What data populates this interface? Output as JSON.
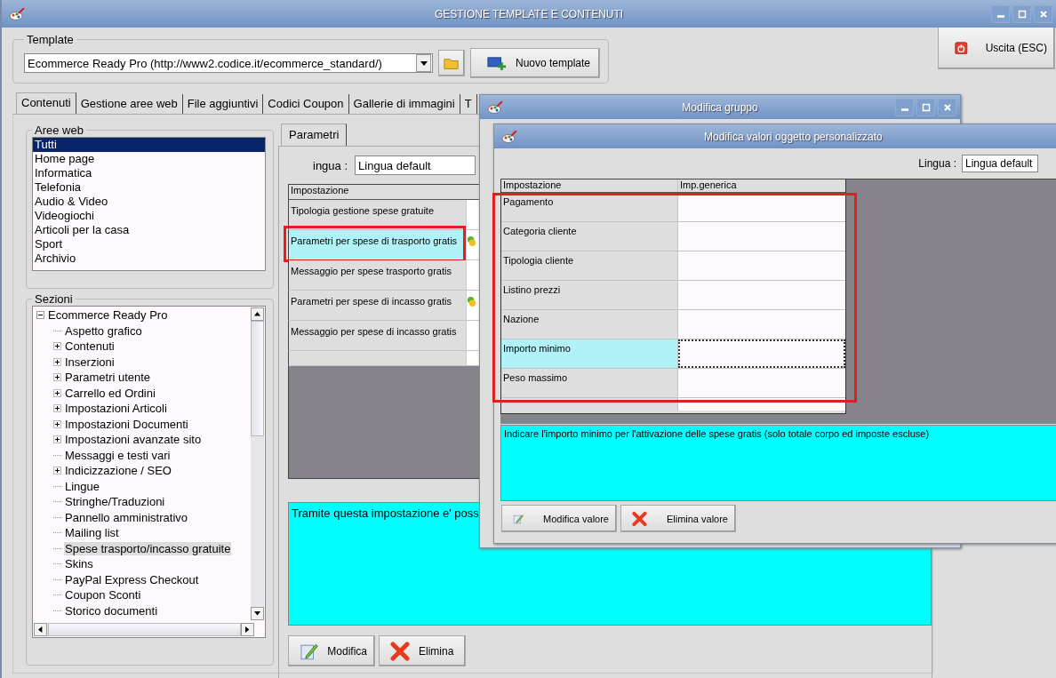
{
  "window": {
    "title": "GESTIONE TEMPLATE E CONTENUTI"
  },
  "template": {
    "label": "Template",
    "value": "Ecommerce Ready Pro (http://www2.codice.it/ecommerce_standard/)",
    "new_button": "Nuovo template"
  },
  "exit_button": "Uscita (ESC)",
  "tabs": [
    {
      "label": "Contenuti",
      "selected": true
    },
    {
      "label": "Gestione aree web",
      "selected": false
    },
    {
      "label": "File aggiuntivi",
      "selected": false
    },
    {
      "label": "Codici Coupon",
      "selected": false
    },
    {
      "label": "Gallerie di immagini",
      "selected": false
    },
    {
      "label": "T",
      "selected": false
    }
  ],
  "web_areas": {
    "label": "Aree web",
    "items": [
      {
        "label": "Tutti",
        "selected": true
      },
      {
        "label": "Home page",
        "selected": false
      },
      {
        "label": "Informatica",
        "selected": false
      },
      {
        "label": "Telefonia",
        "selected": false
      },
      {
        "label": "Audio & Video",
        "selected": false
      },
      {
        "label": "Videogiochi",
        "selected": false
      },
      {
        "label": "Articoli per la casa",
        "selected": false
      },
      {
        "label": "Sport",
        "selected": false
      },
      {
        "label": "Archivio",
        "selected": false
      }
    ]
  },
  "sections": {
    "label": "Sezioni",
    "tree": [
      {
        "label": "Ecommerce Ready Pro",
        "expanded": true,
        "selected": false,
        "children": [
          {
            "label": "Aspetto grafico",
            "expandable": false,
            "selected": false
          },
          {
            "label": "Contenuti",
            "expandable": true,
            "selected": false
          },
          {
            "label": "Inserzioni",
            "expandable": true,
            "selected": false
          },
          {
            "label": "Parametri utente",
            "expandable": true,
            "selected": false
          },
          {
            "label": "Carrello ed Ordini",
            "expandable": true,
            "selected": false
          },
          {
            "label": "Impostazioni Articoli",
            "expandable": true,
            "selected": false
          },
          {
            "label": "Impostazioni Documenti",
            "expandable": true,
            "selected": false
          },
          {
            "label": "Impostazioni avanzate sito",
            "expandable": true,
            "selected": false
          },
          {
            "label": "Messaggi e testi vari",
            "expandable": false,
            "selected": false
          },
          {
            "label": "Indicizzazione / SEO",
            "expandable": true,
            "selected": false
          },
          {
            "label": "Lingue",
            "expandable": false,
            "selected": false
          },
          {
            "label": "Stringhe/Traduzioni",
            "expandable": false,
            "selected": false
          },
          {
            "label": "Pannello amministrativo",
            "expandable": false,
            "selected": false
          },
          {
            "label": "Mailing list",
            "expandable": false,
            "selected": false
          },
          {
            "label": "Spese trasporto/incasso gratuite",
            "expandable": false,
            "selected": true
          },
          {
            "label": "Skins",
            "expandable": false,
            "selected": false
          },
          {
            "label": "PayPal Express Checkout",
            "expandable": false,
            "selected": false
          },
          {
            "label": "Coupon Sconti",
            "expandable": false,
            "selected": false
          },
          {
            "label": "Storico documenti",
            "expandable": false,
            "selected": false
          }
        ]
      }
    ]
  },
  "parameters": {
    "tab": "Parametri",
    "language_label": "ingua :",
    "language": "Lingua default",
    "column": "Impostazione",
    "rows": [
      {
        "label": "Tipologia gestione spese gratuite",
        "kind": "text",
        "selected": false,
        "highlighted": false
      },
      {
        "label": "Parametri per spese di trasporto gratis",
        "kind": "group",
        "selected": true,
        "highlighted": true
      },
      {
        "label": "Messaggio per spese trasporto gratis",
        "kind": "text",
        "selected": false,
        "highlighted": false
      },
      {
        "label": "Parametri per spese di incasso gratis",
        "kind": "group",
        "selected": false,
        "highlighted": false
      },
      {
        "label": "Messaggio per spese di incasso gratis",
        "kind": "text",
        "selected": false,
        "highlighted": false
      }
    ],
    "description": "Tramite questa impostazione e' poss",
    "buttons": [
      {
        "label": "Modifica",
        "kind": "edit"
      },
      {
        "label": "Elimina",
        "kind": "delete"
      }
    ]
  },
  "dialogs": [
    {
      "title": "Modifica gruppo"
    },
    {
      "title": "Modifica valori oggetto personalizzato",
      "language_label": "Lingua :",
      "language": "Lingua default",
      "highlighted": true,
      "columns": [
        "Impostazione",
        "Imp.generica"
      ],
      "rows": [
        {
          "label": "Pagamento",
          "selected": false
        },
        {
          "label": "Categoria cliente",
          "selected": false
        },
        {
          "label": "Tipologia cliente",
          "selected": false
        },
        {
          "label": "Listino prezzi",
          "selected": false
        },
        {
          "label": "Nazione",
          "selected": false
        },
        {
          "label": "Importo minimo",
          "selected": true
        },
        {
          "label": "Peso massimo",
          "selected": false
        }
      ],
      "description": "Indicare l'importo minimo per l'attivazione delle spese gratis (solo totale corpo ed imposte escluse)",
      "buttons": [
        {
          "label": "Modifica valore",
          "kind": "edit"
        },
        {
          "label": "Elimina valore",
          "kind": "delete"
        }
      ]
    }
  ]
}
